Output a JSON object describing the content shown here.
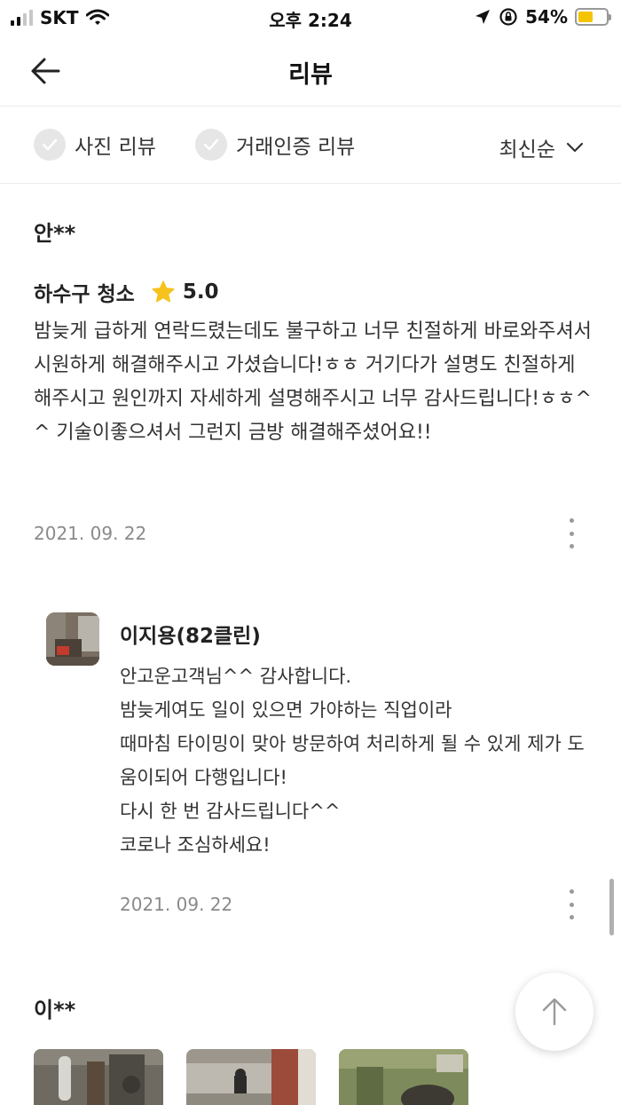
{
  "status_bar": {
    "carrier": "SKT",
    "time": "오후 2:24",
    "battery_percent": "54%",
    "battery_level": 0.54,
    "battery_color": "#f5c400"
  },
  "header": {
    "title": "리뷰",
    "back_icon": "arrow-left-icon"
  },
  "filters": {
    "photo_review": "사진 리뷰",
    "verified_review": "거래인증 리뷰",
    "sort": "최신순"
  },
  "review": {
    "reviewer": "안**",
    "service": "하수구 청소",
    "rating": "5.0",
    "star_color": "#f7c21c",
    "text": "밤늦게 급하게 연락드렸는데도 불구하고 너무 친절하게 바로와주셔서 시원하게 해결해주시고 가셨습니다!ㅎㅎ 거기다가 설명도 친절하게 해주시고 원인까지 자세하게 설명해주시고 너무 감사드립니다!ㅎㅎ^^ 기술이좋으셔서 그런지 금방 해결해주셨어요!!",
    "date": "2021. 09. 22"
  },
  "reply": {
    "owner_name": "이지용(82클린)",
    "lines": [
      "안고운고객님^^ 감사합니다.",
      "밤늦게여도 일이 있으면 가야하는 직업이라",
      "때마침 타이밍이 맞아 방문하여 처리하게 될 수 있게 제가 도움이되어 다행입니다!",
      "다시 한 번 감사드립니다^^",
      "코로나 조심하세요!"
    ],
    "date": "2021. 09. 22"
  },
  "next_review": {
    "reviewer": "이**"
  }
}
